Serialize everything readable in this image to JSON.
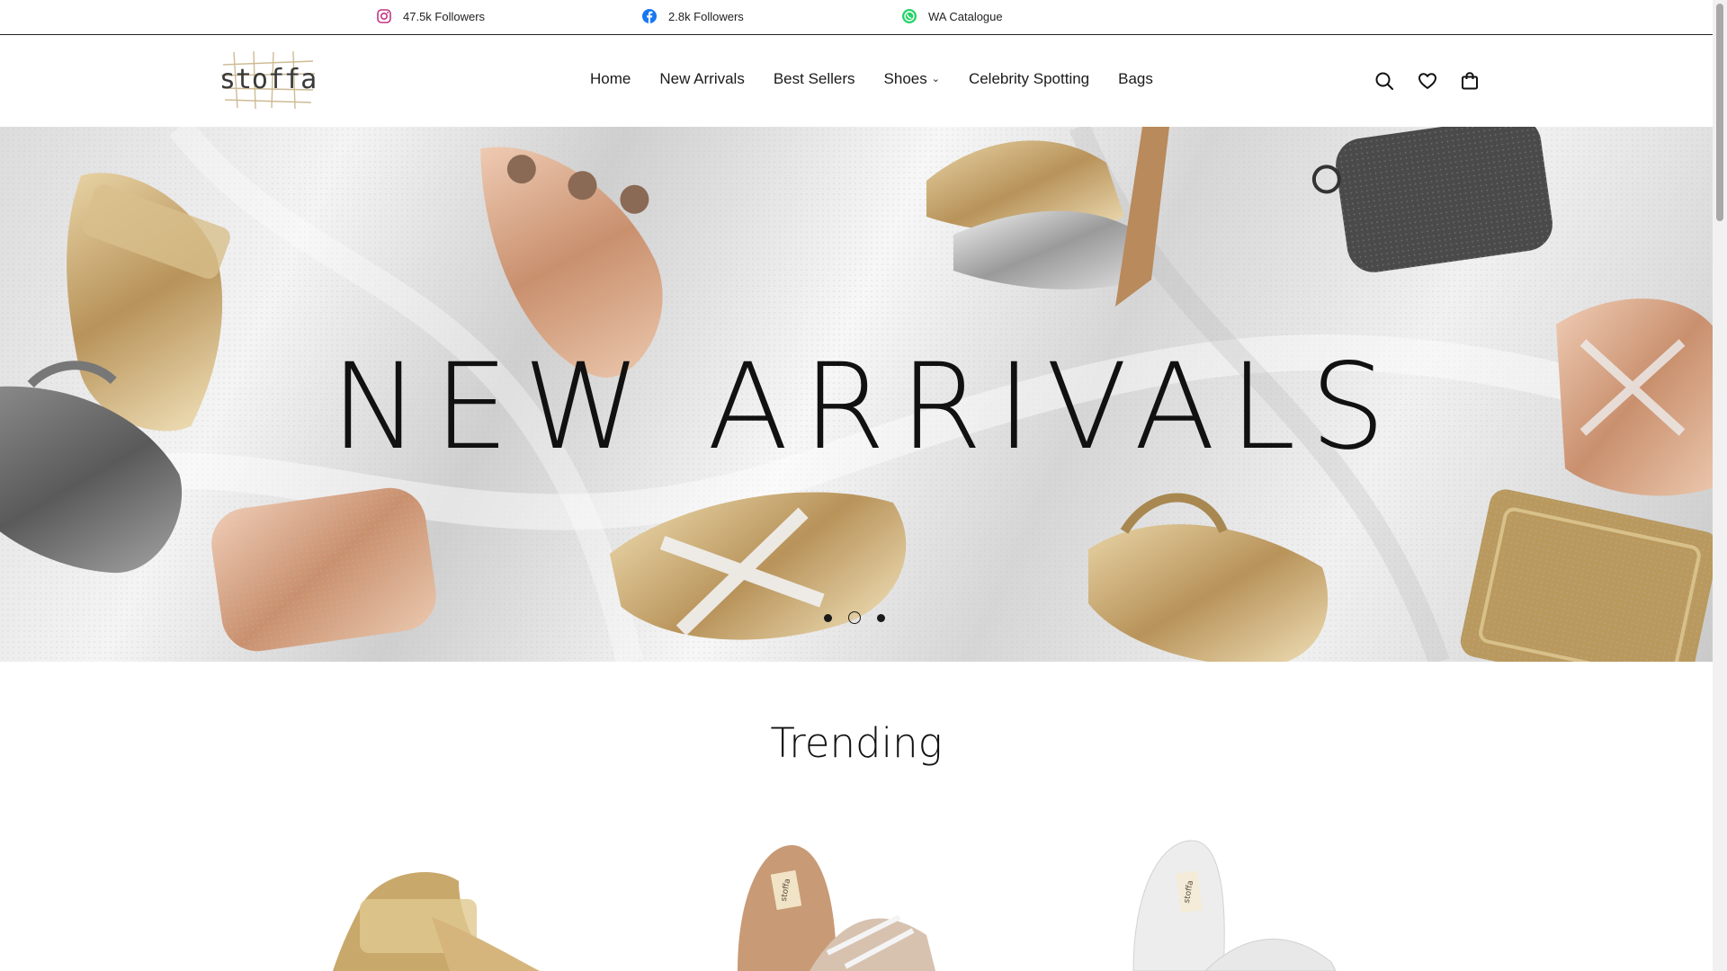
{
  "topbar": {
    "social": [
      {
        "icon": "instagram-icon",
        "label": "47.5k Followers",
        "color": "#c13584"
      },
      {
        "icon": "facebook-icon",
        "label": "2.8k Followers",
        "color": "#1877f2"
      },
      {
        "icon": "whatsapp-icon",
        "label": "WA Catalogue",
        "color": "#25d366"
      }
    ]
  },
  "header": {
    "logo_text": "stoffa",
    "nav": [
      "Home",
      "New Arrivals",
      "Best Sellers",
      "Shoes",
      "Celebrity Spotting",
      "Bags"
    ],
    "shoes_caret": "⌄",
    "icons": [
      "search-icon",
      "heart-icon",
      "bag-icon"
    ]
  },
  "hero": {
    "title": "NEW ARRIVALS",
    "slide_count": 3,
    "active_slide": 2
  },
  "trending": {
    "title": "Trending",
    "brand_stamp": "stoffa"
  },
  "colors": {
    "text": "#1a1a1a",
    "gold": "#c9a66b",
    "rose_gold": "#d9a88a",
    "silver": "#bdbdbd"
  }
}
